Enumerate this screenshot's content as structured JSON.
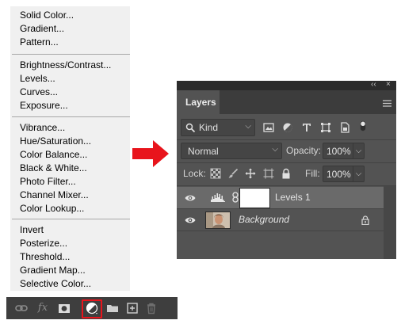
{
  "adjustment_menu": {
    "group_fill": [
      "Solid Color...",
      "Gradient...",
      "Pattern..."
    ],
    "group_tone": [
      "Brightness/Contrast...",
      "Levels...",
      "Curves...",
      "Exposure..."
    ],
    "group_color": [
      "Vibrance...",
      "Hue/Saturation...",
      "Color Balance...",
      "Black & White...",
      "Photo Filter...",
      "Channel Mixer...",
      "Color Lookup..."
    ],
    "group_other": [
      "Invert",
      "Posterize...",
      "Threshold...",
      "Gradient Map...",
      "Selective Color..."
    ]
  },
  "toolbar": {
    "fx_label": "fx",
    "highlight_color": "#e8141c",
    "buttons": [
      "link-layers",
      "layer-style",
      "add-mask",
      "new-adjustment-layer",
      "new-group",
      "new-layer",
      "delete-layer"
    ]
  },
  "arrow_color": "#e8141c",
  "layers_panel": {
    "collapse_glyph": "‹‹",
    "close_glyph": "×",
    "tab_label": "Layers",
    "filter": {
      "kind_label": "Kind",
      "chevron": "⌵"
    },
    "blend_mode": "Normal",
    "opacity_label": "Opacity:",
    "opacity_value": "100%",
    "lock_label": "Lock:",
    "fill_label": "Fill:",
    "fill_value": "100%",
    "layers": [
      {
        "name": "Levels 1",
        "selected": true,
        "italic": false
      },
      {
        "name": "Background",
        "selected": false,
        "italic": true,
        "locked": true
      }
    ]
  }
}
